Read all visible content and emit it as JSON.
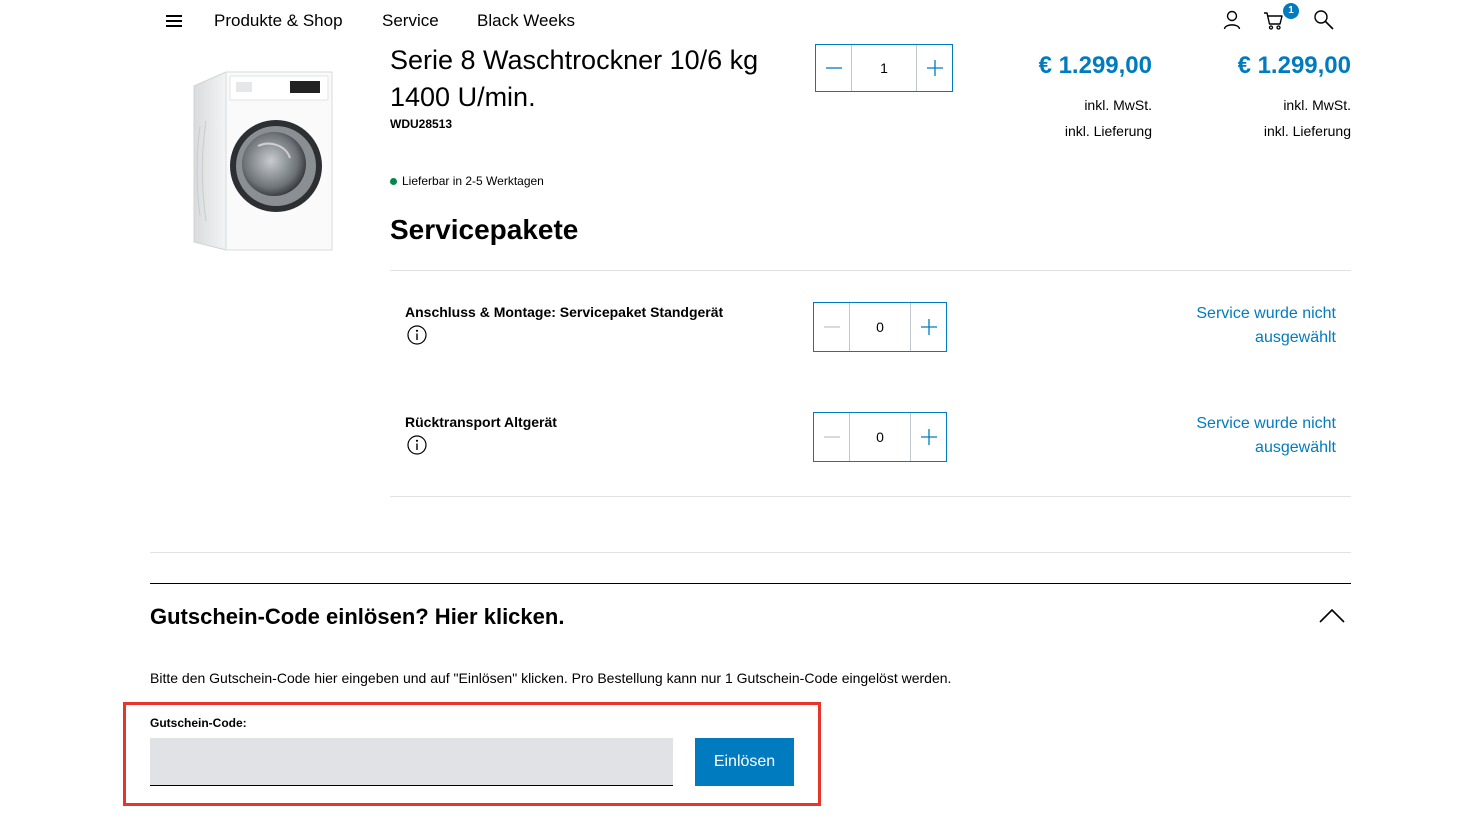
{
  "header": {
    "nav": [
      "Produkte & Shop",
      "Service",
      "Black Weeks"
    ],
    "cart_count": "1",
    "icons": [
      "menu-icon",
      "user-icon",
      "cart-icon",
      "search-icon"
    ]
  },
  "product": {
    "title": "Serie 8 Waschtrockner 10/6 kg 1400 U/min.",
    "sku": "WDU28513",
    "availability": "Lieferbar in 2-5 Werktagen",
    "quantity": "1",
    "unit_price": "€ 1.299,00",
    "total_price": "€ 1.299,00",
    "vat_note": "inkl. MwSt.",
    "delivery_note": "inkl. Lieferung"
  },
  "services": {
    "title": "Servicepakete",
    "items": [
      {
        "name": "Anschluss & Montage: Servicepaket Standgerät",
        "quantity": "0",
        "status": "Service wurde nicht ausgewählt"
      },
      {
        "name": "Rücktransport Altgerät",
        "quantity": "0",
        "status": "Service wurde nicht ausgewählt"
      }
    ]
  },
  "voucher": {
    "title": "Gutschein-Code einlösen? Hier klicken.",
    "hint": "Bitte den Gutschein-Code hier eingeben und auf \"Einlösen\" klicken. Pro Bestellung kann nur 1 Gutschein-Code eingelöst werden.",
    "label": "Gutschein-Code:",
    "value": "",
    "button": "Einlösen"
  },
  "colors": {
    "accent": "#007bc0",
    "available": "#00884a",
    "highlight": "#e8352b",
    "input_bg": "#e0e2e5"
  }
}
